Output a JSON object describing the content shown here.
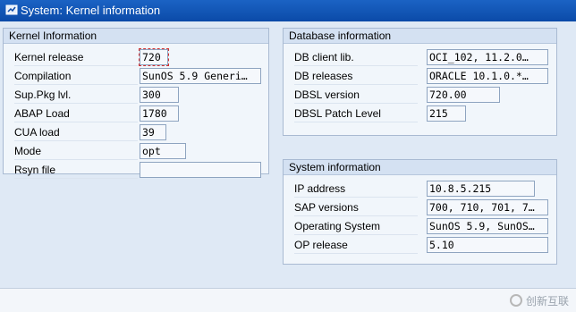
{
  "window": {
    "title": "System: Kernel information"
  },
  "kernel": {
    "heading": "Kernel Information",
    "rows": [
      {
        "label": "Kernel release",
        "value": "720"
      },
      {
        "label": "Compilation",
        "value": "SunOS 5.9 Generi…"
      },
      {
        "label": "Sup.Pkg lvl.",
        "value": "300"
      },
      {
        "label": "ABAP Load",
        "value": "1780"
      },
      {
        "label": "CUA load",
        "value": "39"
      },
      {
        "label": "Mode",
        "value": "opt"
      },
      {
        "label": "Rsyn file",
        "value": ""
      }
    ]
  },
  "database": {
    "heading": "Database information",
    "rows": [
      {
        "label": "DB client lib.",
        "value": "OCI_102, 11.2.0…"
      },
      {
        "label": "DB releases",
        "value": "ORACLE 10.1.0.*…"
      },
      {
        "label": "DBSL version",
        "value": "720.00"
      },
      {
        "label": "DBSL Patch Level",
        "value": "215"
      }
    ]
  },
  "system": {
    "heading": "System information",
    "rows": [
      {
        "label": "IP address",
        "value": "10.8.5.215"
      },
      {
        "label": "SAP versions",
        "value": "700, 710, 701, 7…"
      },
      {
        "label": "Operating System",
        "value": "SunOS 5.9, SunOS…"
      },
      {
        "label": "OP release",
        "value": "5.10"
      }
    ]
  },
  "footer": {
    "brand_text": "创新互联"
  },
  "colors": {
    "titlebar": "#0b4aa8",
    "selection_marker": "#d32f2f"
  }
}
